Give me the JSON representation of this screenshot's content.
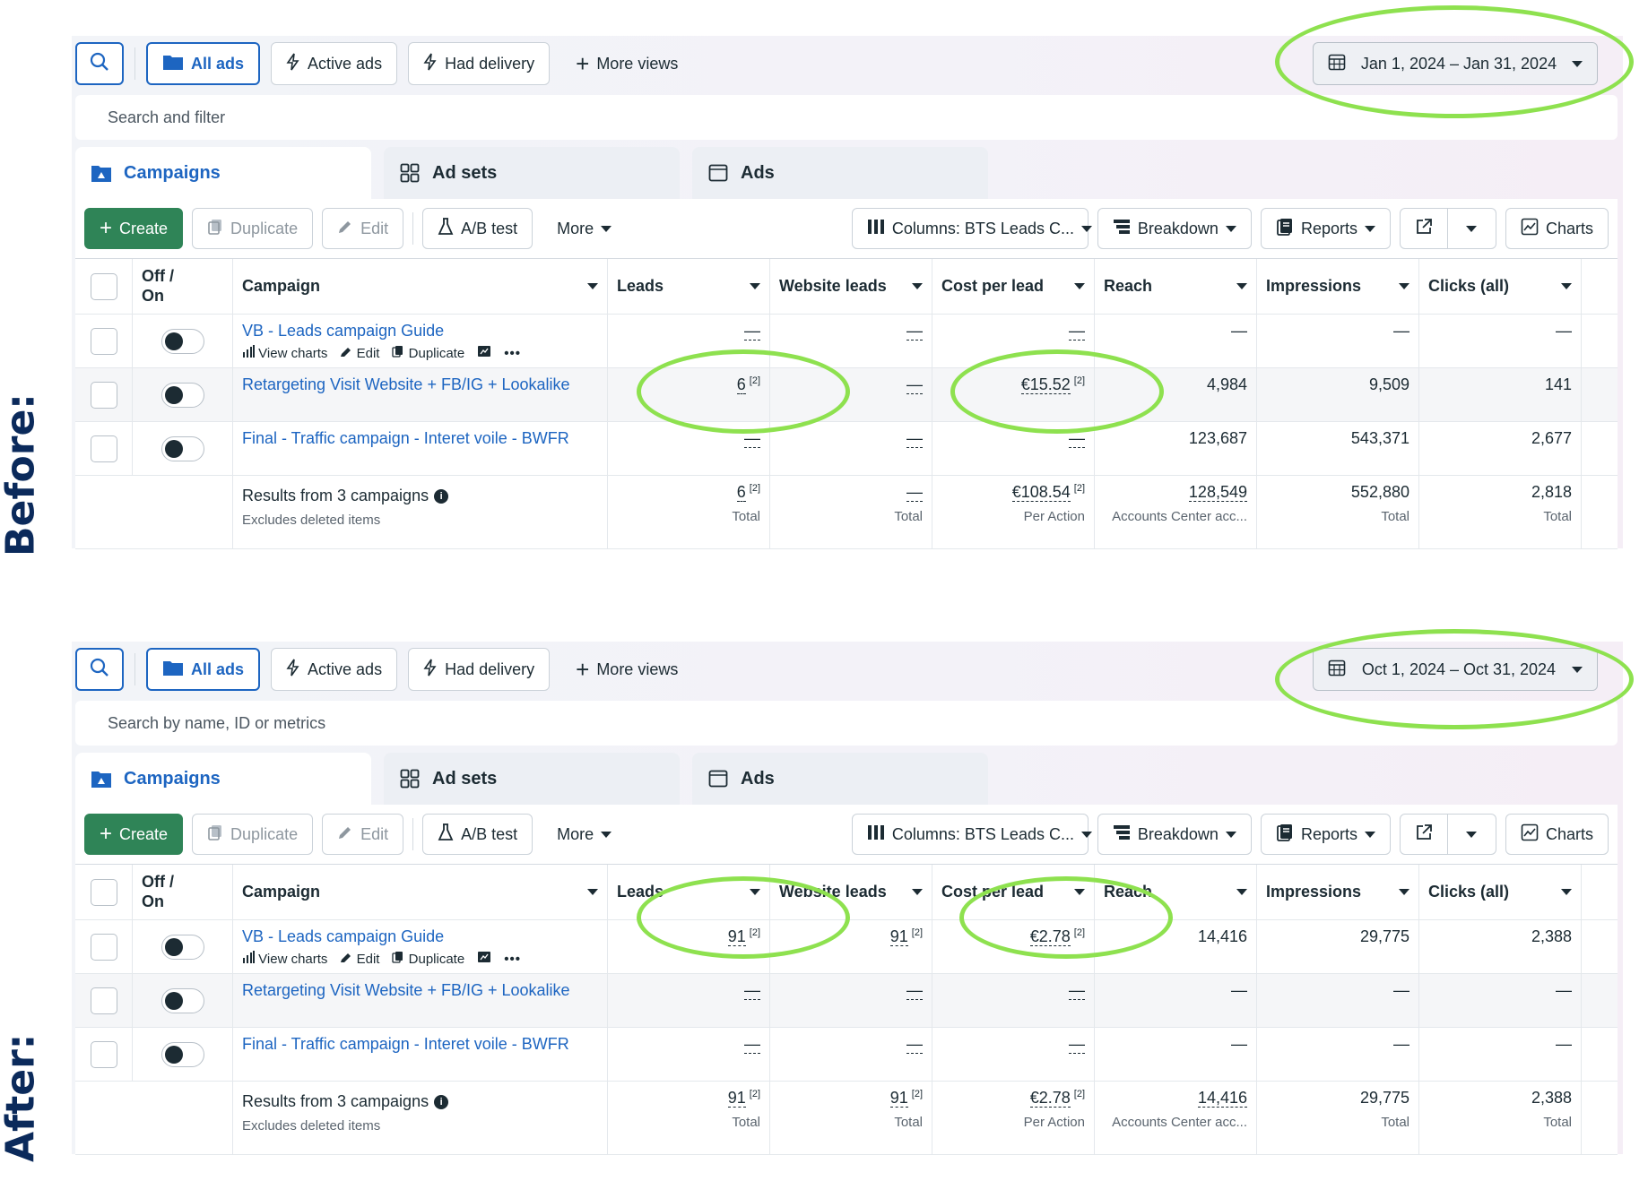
{
  "labels": {
    "before": "Before:",
    "after": "After:"
  },
  "accent_color": "#1d65c1",
  "highlight_color": "#8ee14f",
  "panels": [
    {
      "topbar": {
        "search_icon": "search-icon",
        "all_ads": "All ads",
        "active_ads": "Active ads",
        "had_delivery": "Had delivery",
        "more_views": "More views",
        "date_range": "Jan 1, 2024 – Jan 31, 2024"
      },
      "search_placeholder": "Search and filter",
      "tabs": {
        "campaigns": "Campaigns",
        "ad_sets": "Ad sets",
        "ads": "Ads"
      },
      "toolbar": {
        "create": "Create",
        "duplicate": "Duplicate",
        "edit": "Edit",
        "ab_test": "A/B test",
        "more": "More",
        "columns": "Columns: BTS Leads C...",
        "breakdown": "Breakdown",
        "reports": "Reports",
        "charts": "Charts"
      },
      "headers": {
        "off_on": "Off / On",
        "campaign": "Campaign",
        "leads": "Leads",
        "website_leads": "Website leads",
        "cost_per_lead": "Cost per lead",
        "reach": "Reach",
        "impressions": "Impressions",
        "clicks": "Clicks (all)"
      },
      "row_actions": {
        "view_charts": "View charts",
        "edit": "Edit",
        "duplicate": "Duplicate"
      },
      "rows": [
        {
          "name": "VB - Leads campaign Guide",
          "leads": "—",
          "website_leads": "—",
          "cost_per_lead": "—",
          "reach": "—",
          "impressions": "—",
          "clicks": "—"
        },
        {
          "name": "Retargeting Visit Website + FB/IG + Lookalike",
          "leads": "6",
          "website_leads": "—",
          "cost_per_lead": "€15.52",
          "reach": "4,984",
          "impressions": "9,509",
          "clicks": "141"
        },
        {
          "name": "Final - Traffic campaign - Interet voile - BWFR",
          "leads": "—",
          "website_leads": "—",
          "cost_per_lead": "—",
          "reach": "123,687",
          "impressions": "543,371",
          "clicks": "2,677"
        }
      ],
      "summary": {
        "title": "Results from 3 campaigns",
        "subtitle": "Excludes deleted items",
        "leads": "6",
        "leads_sub": "Total",
        "website_leads": "—",
        "website_leads_sub": "Total",
        "cost_per_lead": "€108.54",
        "cost_per_lead_sub": "Per Action",
        "reach": "128,549",
        "reach_sub": "Accounts Center acc...",
        "impressions": "552,880",
        "impressions_sub": "Total",
        "clicks": "2,818",
        "clicks_sub": "Total"
      },
      "footnote_mark": "[2]"
    },
    {
      "topbar": {
        "search_icon": "search-icon",
        "all_ads": "All ads",
        "active_ads": "Active ads",
        "had_delivery": "Had delivery",
        "more_views": "More views",
        "date_range": "Oct 1, 2024 – Oct 31, 2024"
      },
      "search_placeholder": "Search by name, ID or metrics",
      "tabs": {
        "campaigns": "Campaigns",
        "ad_sets": "Ad sets",
        "ads": "Ads"
      },
      "toolbar": {
        "create": "Create",
        "duplicate": "Duplicate",
        "edit": "Edit",
        "ab_test": "A/B test",
        "more": "More",
        "columns": "Columns: BTS Leads C...",
        "breakdown": "Breakdown",
        "reports": "Reports",
        "charts": "Charts"
      },
      "headers": {
        "off_on": "Off / On",
        "campaign": "Campaign",
        "leads": "Leads",
        "website_leads": "Website leads",
        "cost_per_lead": "Cost per lead",
        "reach": "Reach",
        "impressions": "Impressions",
        "clicks": "Clicks (all)"
      },
      "row_actions": {
        "view_charts": "View charts",
        "edit": "Edit",
        "duplicate": "Duplicate"
      },
      "rows": [
        {
          "name": "VB - Leads campaign Guide",
          "leads": "91",
          "website_leads": "91",
          "cost_per_lead": "€2.78",
          "reach": "14,416",
          "impressions": "29,775",
          "clicks": "2,388"
        },
        {
          "name": "Retargeting Visit Website + FB/IG + Lookalike",
          "leads": "—",
          "website_leads": "—",
          "cost_per_lead": "—",
          "reach": "—",
          "impressions": "—",
          "clicks": "—"
        },
        {
          "name": "Final - Traffic campaign - Interet voile - BWFR",
          "leads": "—",
          "website_leads": "—",
          "cost_per_lead": "—",
          "reach": "—",
          "impressions": "—",
          "clicks": "—"
        }
      ],
      "summary": {
        "title": "Results from 3 campaigns",
        "subtitle": "Excludes deleted items",
        "leads": "91",
        "leads_sub": "Total",
        "website_leads": "91",
        "website_leads_sub": "Total",
        "cost_per_lead": "€2.78",
        "cost_per_lead_sub": "Per Action",
        "reach": "14,416",
        "reach_sub": "Accounts Center acc...",
        "impressions": "29,775",
        "impressions_sub": "Total",
        "clicks": "2,388",
        "clicks_sub": "Total"
      },
      "footnote_mark": "[2]"
    }
  ]
}
